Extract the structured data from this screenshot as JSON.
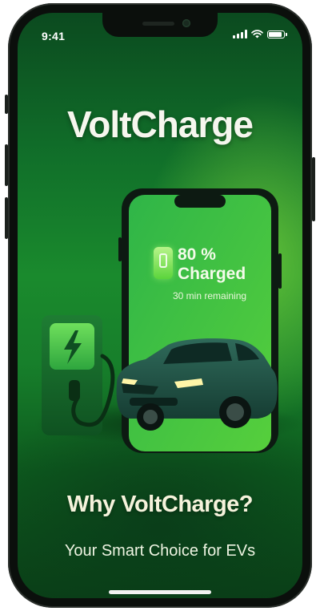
{
  "status_bar": {
    "time": "9:41",
    "signal_icon": "signal-bars-icon",
    "wifi_icon": "wifi-icon",
    "battery_icon": "battery-icon"
  },
  "app": {
    "title": "VoltCharge"
  },
  "charging_card": {
    "percent": "80 %",
    "status": "Charged",
    "remaining": "30 min remaining",
    "progress": 0.8
  },
  "promo": {
    "headline": "Why VoltCharge?",
    "subheadline": "Your Smart Choice for EVs"
  },
  "colors": {
    "background_dark": "#0a3f17",
    "background_mid": "#1a8a2d",
    "accent_glow": "#7bd23c",
    "title_text": "#f6f6ee"
  },
  "illustration": {
    "charger_icon": "lightning-bolt-icon",
    "vehicle": "electric-suv"
  }
}
